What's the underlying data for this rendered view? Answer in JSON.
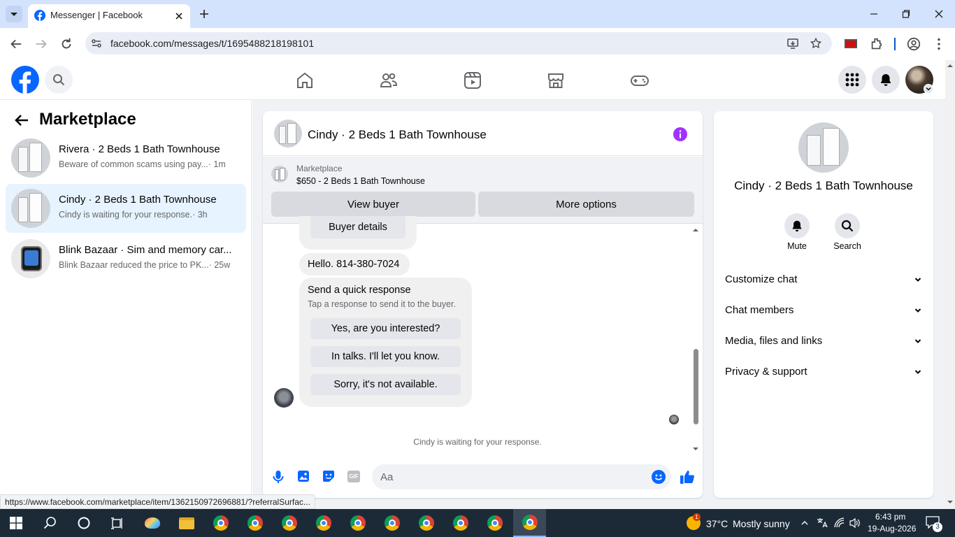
{
  "browser": {
    "tab_title": "Messenger | Facebook",
    "url": "facebook.com/messages/t/1695488218198101",
    "status_url": "https://www.facebook.com/marketplace/item/1362150972696881/?referralSurfac..."
  },
  "sidebar": {
    "title": "Marketplace",
    "conversations": [
      {
        "title": "Rivera · 2 Beds 1 Bath Townhouse",
        "subtitle": "Beware of common scams using pay...",
        "time": "· 1m"
      },
      {
        "title": "Cindy · 2 Beds 1 Bath Townhouse",
        "subtitle": "Cindy is waiting for your response.",
        "time": "· 3h"
      },
      {
        "title": "Blink Bazaar · Sim and memory car...",
        "subtitle": "Blink Bazaar reduced the price to PK...",
        "time": "· 25w"
      }
    ]
  },
  "chat": {
    "title": "Cindy · 2 Beds 1 Bath Townhouse",
    "marketplace_label": "Marketplace",
    "listing": "$650 - 2 Beds 1 Bath Townhouse",
    "view_buyer": "View buyer",
    "more_options": "More options",
    "buyer_details": "Buyer details",
    "message": "Hello. 814-380-7024",
    "quick_title": "Send a quick response",
    "quick_sub": "Tap a response to send it to the buyer.",
    "quick_replies": [
      "Yes, are you interested?",
      "In talks. I'll let you know.",
      "Sorry, it's not available."
    ],
    "waiting": "Cindy is waiting for your response.",
    "input_placeholder": "Aa"
  },
  "info": {
    "name": "Cindy · 2 Beds 1 Bath Townhouse",
    "mute": "Mute",
    "search": "Search",
    "sections": [
      "Customize chat",
      "Chat members",
      "Media, files and links",
      "Privacy & support"
    ]
  },
  "taskbar": {
    "weather_temp": "37°C",
    "weather_desc": "Mostly sunny",
    "weather_badge": "1",
    "time": "6:43 pm",
    "date": "19-Aug-2026",
    "notif_count": "3"
  },
  "colors": {
    "fb_blue": "#0866ff",
    "messenger_purple": "#a033ff",
    "active_item": "#e7f3ff"
  }
}
